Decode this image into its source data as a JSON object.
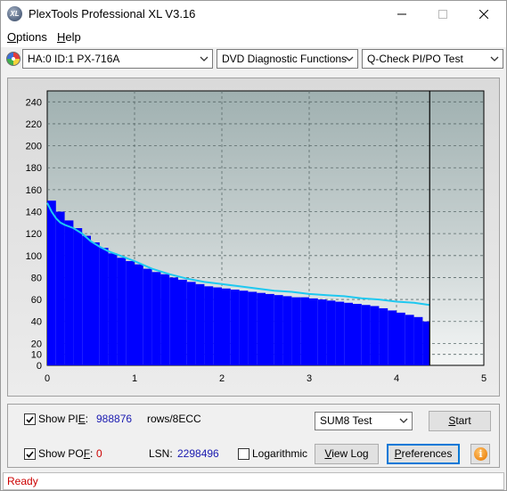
{
  "window": {
    "app_icon_text": "XL",
    "title": "PlexTools Professional XL V3.16"
  },
  "menu": {
    "options_first": "O",
    "options_rest": "ptions",
    "help_first": "H",
    "help_rest": "elp"
  },
  "toolbar": {
    "drive": "HA:0 ID:1  PX-716A",
    "function": "DVD Diagnostic Functions",
    "test": "Q-Check PI/PO Test"
  },
  "chart_data": {
    "type": "bar",
    "title": "",
    "xlabel": "",
    "ylabel": "",
    "xlim": [
      0,
      5
    ],
    "ylim": [
      0,
      250
    ],
    "x_ticks": [
      "0",
      "1",
      "2",
      "3",
      "4",
      "5"
    ],
    "y_ticks": [
      "0",
      "10",
      "20",
      "40",
      "60",
      "80",
      "100",
      "120",
      "140",
      "160",
      "180",
      "200",
      "220",
      "240"
    ],
    "grid": true,
    "end_marker_x": 4.38,
    "series": [
      {
        "kind": "bar",
        "color": "#0000ff",
        "x": [
          0.0,
          0.1,
          0.2,
          0.3,
          0.4,
          0.5,
          0.6,
          0.7,
          0.8,
          0.9,
          1.0,
          1.1,
          1.2,
          1.3,
          1.4,
          1.5,
          1.6,
          1.7,
          1.8,
          1.9,
          2.0,
          2.1,
          2.2,
          2.3,
          2.4,
          2.5,
          2.6,
          2.7,
          2.8,
          2.9,
          3.0,
          3.1,
          3.2,
          3.3,
          3.4,
          3.5,
          3.6,
          3.7,
          3.8,
          3.9,
          4.0,
          4.1,
          4.2,
          4.3,
          4.38
        ],
        "values": [
          150,
          140,
          132,
          125,
          118,
          112,
          107,
          102,
          98,
          95,
          92,
          88,
          85,
          83,
          80,
          78,
          76,
          74,
          72,
          71,
          70,
          69,
          68,
          67,
          66,
          65,
          64,
          63,
          62,
          62,
          61,
          60,
          59,
          58,
          57,
          56,
          55,
          54,
          52,
          50,
          48,
          46,
          44,
          40,
          30
        ]
      },
      {
        "kind": "line",
        "color": "#1ec8f0",
        "x": [
          0.0,
          0.05,
          0.1,
          0.15,
          0.2,
          0.3,
          0.4,
          0.5,
          0.6,
          0.7,
          0.8,
          0.9,
          1.0,
          1.2,
          1.4,
          1.6,
          1.8,
          2.0,
          2.2,
          2.4,
          2.6,
          2.8,
          3.0,
          3.2,
          3.4,
          3.6,
          3.8,
          4.0,
          4.2,
          4.38
        ],
        "values": [
          148,
          140,
          134,
          130,
          128,
          125,
          120,
          113,
          108,
          104,
          101,
          98,
          95,
          88,
          83,
          79,
          76,
          74,
          72,
          70,
          68,
          67,
          65,
          64,
          63,
          61,
          60,
          58,
          57,
          55
        ]
      }
    ]
  },
  "bottom": {
    "show_pie_label_a": "Show PI",
    "show_pie_label_b": "E",
    "show_pie_colon": ":",
    "pie_value": "988876",
    "pie_unit": "rows/8ECC",
    "show_pof_label_a": "Show PO",
    "show_pof_label_b": "F",
    "show_pof_colon": ":",
    "pof_value": "0",
    "lsn_label": "LSN:",
    "lsn_value": "2298496",
    "logarithmic_label": "Logarithmic",
    "test_select": "SUM8 Test",
    "start_first": "S",
    "start_rest": "tart",
    "view_log_first": "V",
    "view_log_rest": "iew Log",
    "preferences_first": "P",
    "preferences_rest": "references",
    "info_glyph": "i"
  },
  "status": {
    "text": "Ready"
  }
}
